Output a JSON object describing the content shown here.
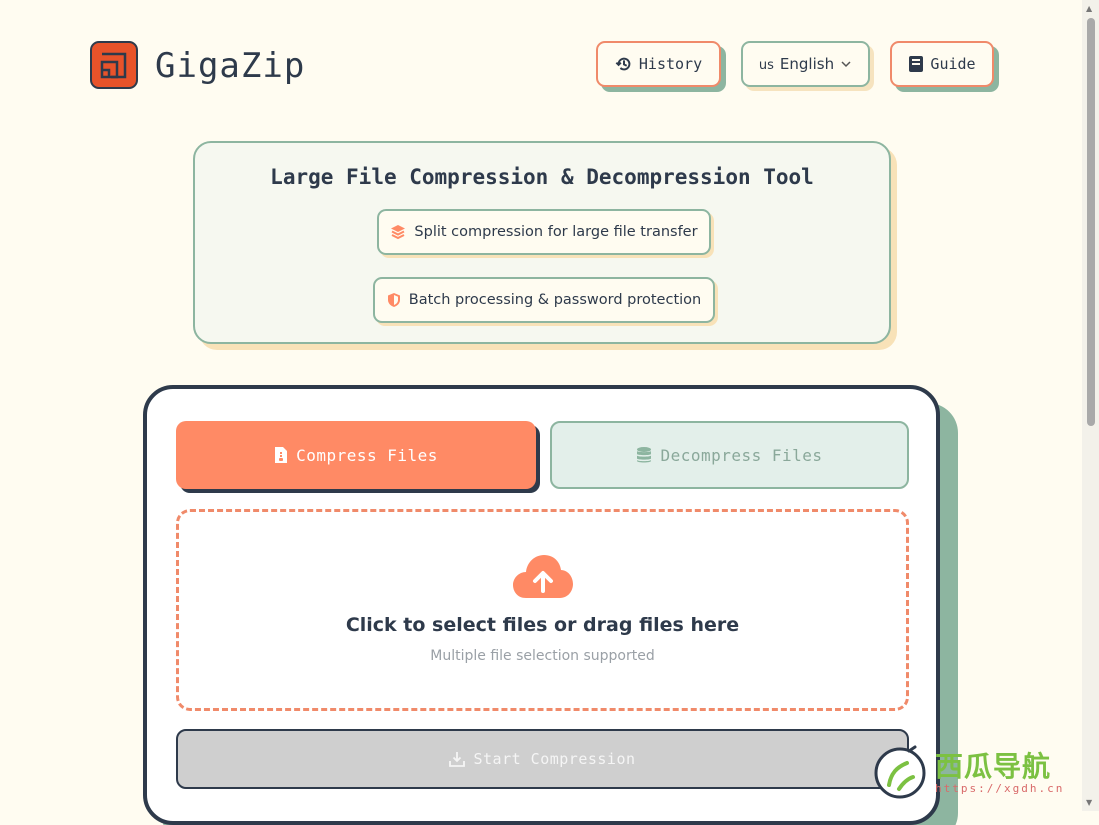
{
  "header": {
    "brand": "GigaZip",
    "history_label": "History",
    "language_flag": "us",
    "language_label": "English",
    "guide_label": "Guide"
  },
  "hero": {
    "title": "Large File Compression & Decompression Tool",
    "features": [
      {
        "label": "Split compression for large file transfer",
        "icon": "layers-icon"
      },
      {
        "label": "Batch processing & password protection",
        "icon": "shield-icon"
      }
    ]
  },
  "main": {
    "tabs": [
      {
        "label": "Compress Files",
        "active": true
      },
      {
        "label": "Decompress Files",
        "active": false
      }
    ],
    "dropzone": {
      "title": "Click to select files or drag files here",
      "subtitle": "Multiple file selection supported"
    },
    "start_label": "Start Compression"
  },
  "watermark": {
    "title": "西瓜导航",
    "url": "https://xgdh.cn"
  },
  "colors": {
    "accent": "#ff8a65",
    "dark": "#2e3a4b",
    "green": "#8db5a0",
    "background": "#fffcf1"
  }
}
